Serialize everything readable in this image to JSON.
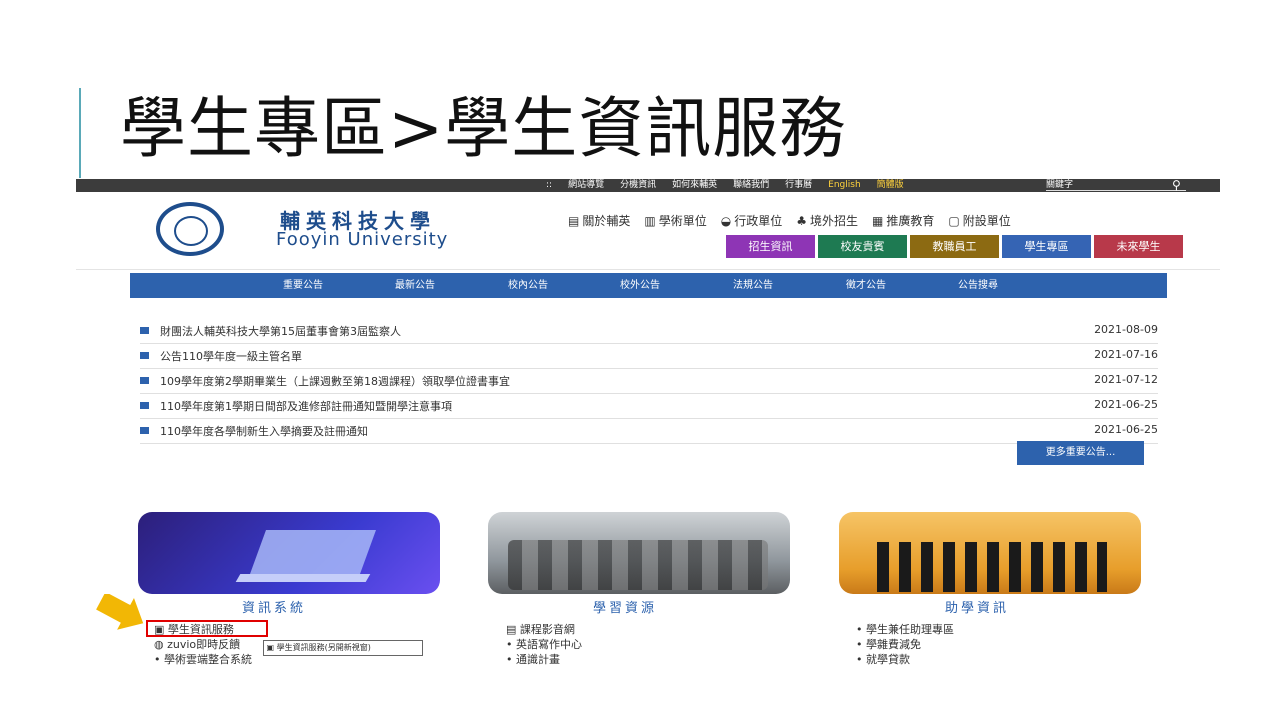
{
  "slide": {
    "title": "學生專區>學生資訊服務"
  },
  "topbar": {
    "links": [
      "::",
      "網站導覽",
      "分機資訊",
      "如何來輔英",
      "聯絡我們",
      "行事曆",
      "English",
      "簡體版"
    ],
    "keyword_label": "關鍵字",
    "search_icon": "search-icon"
  },
  "header": {
    "logo_cn": "輔英科技大學",
    "logo_en": "Fooyin University",
    "nav": [
      {
        "icon": "doc-icon",
        "glyph": "▤",
        "label": "關於輔英"
      },
      {
        "icon": "book-icon",
        "glyph": "▥",
        "label": "學術單位"
      },
      {
        "icon": "bowl-icon",
        "glyph": "◒",
        "label": "行政單位"
      },
      {
        "icon": "people-icon",
        "glyph": "♣",
        "label": "境外招生"
      },
      {
        "icon": "building-icon",
        "glyph": "▦",
        "label": "推廣教育"
      },
      {
        "icon": "window-icon",
        "glyph": "▢",
        "label": "附設單位"
      }
    ],
    "buttons": [
      {
        "label": "招生資訊",
        "color": "#8e35b5"
      },
      {
        "label": "校友貴賓",
        "color": "#1e7a52"
      },
      {
        "label": "教職員工",
        "color": "#8c6a12"
      },
      {
        "label": "學生專區",
        "color": "#3564b4"
      },
      {
        "label": "未來學生",
        "color": "#b8394a"
      }
    ]
  },
  "tabs": [
    "重要公告",
    "最新公告",
    "校內公告",
    "校外公告",
    "法規公告",
    "徵才公告",
    "公告搜尋"
  ],
  "news": [
    {
      "title": "財團法人輔英科技大學第15屆董事會第3屆監察人",
      "date": "2021-08-09"
    },
    {
      "title": "公告110學年度一級主管名單",
      "date": "2021-07-16"
    },
    {
      "title": "109學年度第2學期畢業生（上課週數至第18週課程）領取學位證書事宜",
      "date": "2021-07-12"
    },
    {
      "title": "110學年度第1學期日間部及進修部註冊通知暨開學注意事項",
      "date": "2021-06-25"
    },
    {
      "title": "110學年度各學制新生入學摘要及註冊通知",
      "date": "2021-06-25"
    }
  ],
  "more_button": "更多重要公告...",
  "sections": [
    {
      "title": "資訊系統",
      "links": [
        "學生資訊服務",
        "zuvio即時反饋",
        "學術雲端整合系統"
      ]
    },
    {
      "title": "學習資源",
      "links": [
        "課程影音網",
        "英語寫作中心",
        "通識計畫"
      ]
    },
    {
      "title": "助學資訊",
      "links": [
        "學生兼任助理專區",
        "學雜費減免",
        "就學貸款"
      ]
    }
  ],
  "tooltip": "學生資訊服務(另開新視窗)",
  "colors": {
    "accent": "#2d62ad",
    "highlight": "#e00000",
    "arrow": "#f2b705"
  }
}
